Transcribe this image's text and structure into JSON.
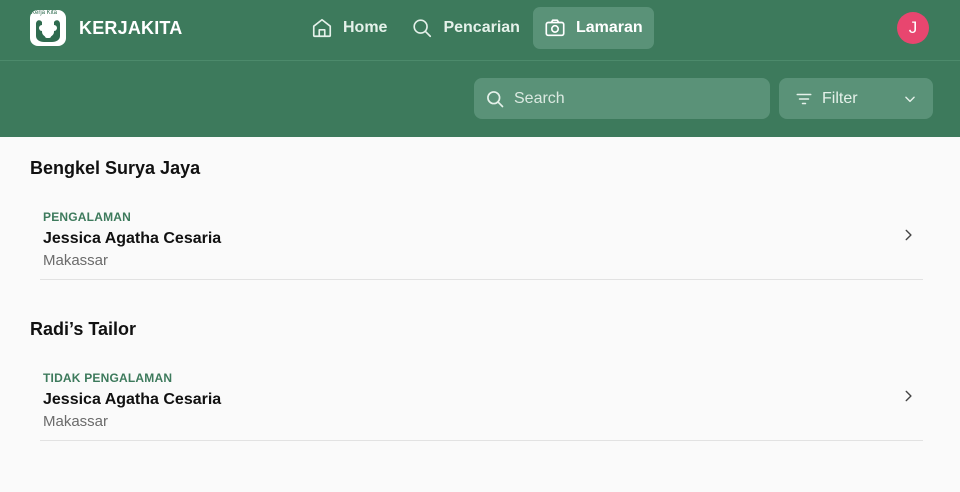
{
  "brand": {
    "logo_text": "Kerja Kita",
    "name": "KERJAKITA"
  },
  "nav": {
    "items": [
      {
        "label": "Home",
        "icon": "home-icon"
      },
      {
        "label": "Pencarian",
        "icon": "search-icon"
      },
      {
        "label": "Lamaran",
        "icon": "camera-icon",
        "active": true
      }
    ]
  },
  "user": {
    "initial": "J"
  },
  "search": {
    "placeholder": "Search",
    "value": ""
  },
  "filter": {
    "label": "Filter"
  },
  "groups": [
    {
      "title": "Bengkel Surya Jaya",
      "items": [
        {
          "tag": "PENGALAMAN",
          "name": "Jessica Agatha Cesaria",
          "city": "Makassar"
        }
      ]
    },
    {
      "title": "Radi’s Tailor",
      "items": [
        {
          "tag": "TIDAK PENGALAMAN",
          "name": "Jessica Agatha Cesaria",
          "city": "Makassar"
        }
      ]
    }
  ],
  "colors": {
    "header": "#3d7a5c",
    "active_nav": "#5a9278",
    "avatar": "#e8466f",
    "accent": "#3d7a5c"
  }
}
